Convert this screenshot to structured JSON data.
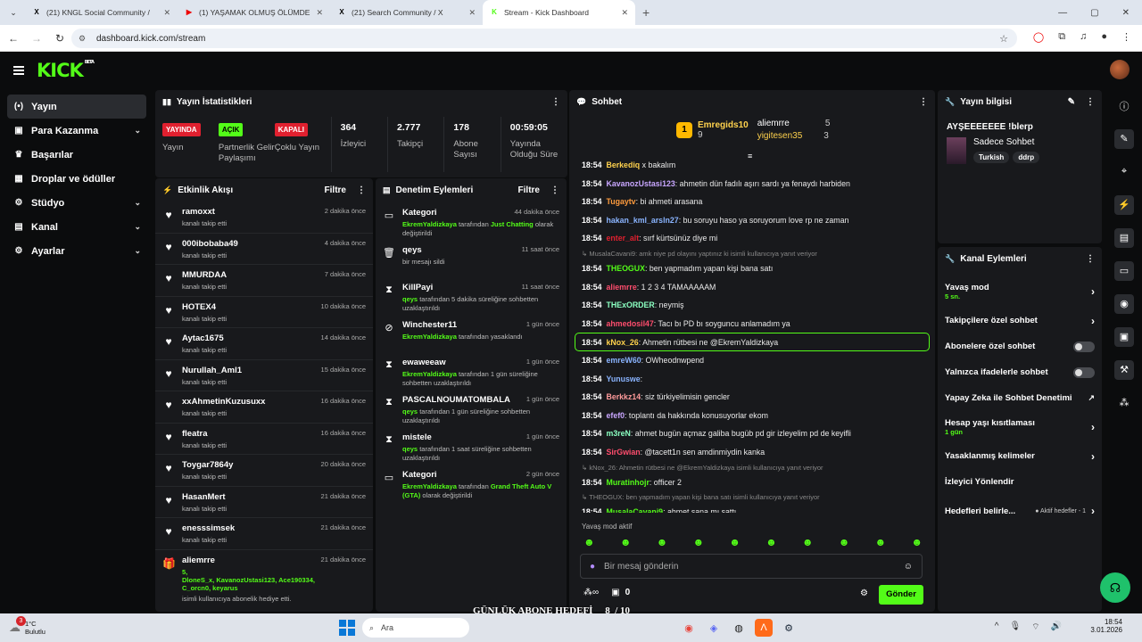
{
  "browser": {
    "tabs": [
      {
        "icon": "X",
        "title": "(21) KNGL Social Community / ",
        "color": "#000"
      },
      {
        "icon": "▶",
        "title": "(1) YAŞAMAK OLMUŞ ÖLÜMDE",
        "color": "#e00"
      },
      {
        "icon": "X",
        "title": "(21) Search Community / X",
        "color": "#000"
      },
      {
        "icon": "K",
        "title": "Stream - Kick Dashboard",
        "color": "#53fc18"
      }
    ],
    "url": "dashboard.kick.com/stream"
  },
  "nav": [
    {
      "icon": "(•)",
      "label": "Yayın",
      "active": true
    },
    {
      "icon": "▣",
      "label": "Para Kazanma",
      "chev": true
    },
    {
      "icon": "♛",
      "label": "Başarılar"
    },
    {
      "icon": "▦",
      "label": "Droplar ve ödüller"
    },
    {
      "icon": "⚙",
      "label": "Stüdyo",
      "chev": true
    },
    {
      "icon": "▤",
      "label": "Kanal",
      "chev": true
    },
    {
      "icon": "⚙",
      "label": "Ayarlar",
      "chev": true
    }
  ],
  "stats": {
    "title": "Yayın İstatistikleri",
    "badges": [
      {
        "text": "YAYINDA",
        "bg": "#e0202f",
        "fg": "#fff",
        "label": "Yayın"
      },
      {
        "text": "AÇIK",
        "bg": "#53fc18",
        "fg": "#000",
        "label": "Partnerlik Gelir Paylaşımı"
      },
      {
        "text": "KAPALI",
        "bg": "#e0202f",
        "fg": "#fff",
        "label": "Çoklu Yayın"
      }
    ],
    "nums": [
      {
        "value": "364",
        "label": "İzleyici"
      },
      {
        "value": "2.777",
        "label": "Takipçi"
      },
      {
        "value": "178",
        "label": "Abone Sayısı"
      },
      {
        "value": "00:59:05",
        "label": "Yayında Olduğu Süre"
      }
    ]
  },
  "activity": {
    "title": "Etkinlik Akışı",
    "filter": "Filtre",
    "items": [
      {
        "name": "ramoxxt",
        "sub": "kanalı takip etti",
        "time": "2 dakika önce"
      },
      {
        "name": "000ibobaba49",
        "sub": "kanalı takip etti",
        "time": "4 dakika önce"
      },
      {
        "name": "MMURDAA",
        "sub": "kanalı takip etti",
        "time": "7 dakika önce"
      },
      {
        "name": "HOTEX4",
        "sub": "kanalı takip etti",
        "time": "10 dakika önce"
      },
      {
        "name": "Aytac1675",
        "sub": "kanalı takip etti",
        "time": "14 dakika önce"
      },
      {
        "name": "Nurullah_Aml1",
        "sub": "kanalı takip etti",
        "time": "15 dakika önce"
      },
      {
        "name": "xxAhmetinKuzusuxx",
        "sub": "kanalı takip etti",
        "time": "16 dakika önce"
      },
      {
        "name": "fleatra",
        "sub": "kanalı takip etti",
        "time": "16 dakika önce"
      },
      {
        "name": "Toygar7864y",
        "sub": "kanalı takip etti",
        "time": "20 dakika önce"
      },
      {
        "name": "HasanMert",
        "sub": "kanalı takip etti",
        "time": "21 dakika önce"
      },
      {
        "name": "enesssimsek",
        "sub": "kanalı takip etti",
        "time": "21 dakika önce"
      }
    ],
    "gift": {
      "name": "aliemrre",
      "count": "5,",
      "recipients": "DloneS_x, KavanozUstasi123, Ace190334, C_orcn0, keyarus",
      "sub": "isimli kullanıcıya abonelik hediye etti.",
      "time": "21 dakika önce"
    }
  },
  "mod": {
    "title": "Denetim Eylemleri",
    "filter": "Filtre",
    "items": [
      {
        "icon": "▭",
        "title": "Kategori",
        "time": "44 dakika önce",
        "user": "EkremYaldizkaya",
        "text": " tarafından ",
        "extra": "Just Chatting",
        "tail": " olarak değiştirildi"
      },
      {
        "icon": "🗑",
        "title": "qeys",
        "time": "11 saat önce",
        "user": "",
        "text": "bir mesajı sildi",
        "extra": "",
        "tail": ""
      },
      {
        "icon": "⧗",
        "title": "KillPayi",
        "time": "11 saat önce",
        "user": "qeys",
        "text": " tarafından 5 dakika süreliğine sohbetten uzaklaştırıldı",
        "extra": "",
        "tail": ""
      },
      {
        "icon": "⊘",
        "title": "Winchester11",
        "time": "1 gün önce",
        "user": "EkremYaldizkaya",
        "text": " tarafından yasaklandı",
        "extra": "",
        "tail": ""
      },
      {
        "icon": "⧗",
        "title": "ewaweeaw",
        "time": "1 gün önce",
        "user": "EkremYaldizkaya",
        "text": " tarafından 1 gün süreliğine sohbetten uzaklaştırıldı",
        "extra": "",
        "tail": ""
      },
      {
        "icon": "⧗",
        "title": "PASCALNOUMATOMBALA",
        "time": "1 gün önce",
        "user": "qeys",
        "text": " tarafından 1 gün süreliğine sohbetten uzaklaştırıldı",
        "extra": "",
        "tail": ""
      },
      {
        "icon": "⧗",
        "title": "mistele",
        "time": "1 gün önce",
        "user": "qeys",
        "text": " tarafından 1 saat süreliğine sohbetten uzaklaştırıldı",
        "extra": "",
        "tail": ""
      },
      {
        "icon": "▭",
        "title": "Kategori",
        "time": "2 gün önce",
        "user": "EkremYaldizkaya",
        "text": " tarafından ",
        "extra": "Grand Theft Auto V (GTA)",
        "tail": " olarak değiştirildi"
      }
    ]
  },
  "chat": {
    "title": "Sohbet",
    "leaders": [
      {
        "name": "Emregids10",
        "n": "9",
        "rank": "1"
      },
      {
        "name": "aliemrre",
        "n": "5"
      },
      {
        "name": "yigitesen35",
        "n": "3"
      }
    ],
    "messages": [
      {
        "t": "18:54",
        "u": "Berkediq",
        "c": "#ffd24d",
        "m": " x bakalım"
      },
      {
        "t": "18:54",
        "u": "KavanozUstasi123",
        "c": "#c8a6ff",
        "m": ": ahmetin dün fadılı aşırı sardı ya fenaydı harbiden"
      },
      {
        "t": "18:54",
        "u": "Tugaytv",
        "c": "#ff9b3d",
        "m": ": bi ahmeti arasana"
      },
      {
        "t": "18:54",
        "u": "hakan_kml_arsln27",
        "c": "#8ab4ff",
        "m": ": bu soruyu haso ya soruyorum love rp ne zaman"
      },
      {
        "t": "18:54",
        "u": "enter_alt",
        "c": "#e0202f",
        "m": ": sırf kürtsünüz diye mi"
      },
      {
        "sys": "MusalaCavani9: amk niye pd olayını yaptınız ki isimli kullanıcıya yanıt veriyor"
      },
      {
        "t": "18:54",
        "u": "THEOGUX",
        "c": "#53fc18",
        "m": ": ben yapmadım yapan kişi bana satı"
      },
      {
        "t": "18:54",
        "u": "aliemrre",
        "c": "#ff4d6d",
        "m": ": 1 2 3 4 TAMAAAAAM"
      },
      {
        "t": "18:54",
        "u": "THExORDER",
        "c": "#8affc1",
        "m": ": neymiş"
      },
      {
        "t": "18:54",
        "u": "ahmedosil47",
        "c": "#ff4d6d",
        "m": ": Tacı bı PD bı soyguncu anlamadım ya"
      },
      {
        "t": "18:54",
        "u": "kNox_26",
        "c": "#ffd24d",
        "m": ": Ahmetin rütbesi ne @EkremYaldizkaya",
        "hl": true
      },
      {
        "t": "18:54",
        "u": "emreW60",
        "c": "#8ab4ff",
        "m": ": OWheodnwpend"
      },
      {
        "t": "18:54",
        "u": "Yunuswe",
        "c": "#8ab4ff",
        "m": ": "
      },
      {
        "t": "18:54",
        "u": "Berkkz14",
        "c": "#ff9b9b",
        "m": ": siz türkiyelimisin gencler"
      },
      {
        "t": "18:54",
        "u": "efef0",
        "c": "#c8a6ff",
        "m": ": toplantı da hakkında konusuyorlar ekom"
      },
      {
        "t": "18:54",
        "u": "m3reN",
        "c": "#8affc1",
        "m": ": ahmet bugün açmaz galiba bugüb pd gir izleyelim pd de keyifli"
      },
      {
        "t": "18:54",
        "u": "SirGwian",
        "c": "#ff4d6d",
        "m": ": @tacett1n sen amdinmiydin kanka"
      },
      {
        "sys": "kNox_26: Ahmetin rütbesi ne @EkremYaldizkaya isimli kullanıcıya yanıt veriyor"
      },
      {
        "t": "18:54",
        "u": "Muratinhojr",
        "c": "#53fc18",
        "m": ": officer 2"
      },
      {
        "sys": "THEOGUX: ben yapmadım yapan kişi bana satı isimli kullanıcıya yanıt veriyor"
      },
      {
        "t": "18:54",
        "u": "MusalaCavani9",
        "c": "#53fc18",
        "m": ": ahmet sana mı sattı"
      }
    ],
    "slow": "Yavaş mod aktif",
    "input_placeholder": "Bir mesaj gönderin",
    "counter": "0",
    "send": "Gönder",
    "overlay": "GÜNLÜK ABONE HEDEFİ     8  / 10"
  },
  "info": {
    "title": "Yayın bilgisi",
    "stream_title": "AYŞEEEEEEE !blerp",
    "category": "Sadece Sohbet",
    "tags": [
      "Turkish",
      "ddrp"
    ]
  },
  "channel": {
    "title": "Kanal Eylemleri",
    "rows": [
      {
        "label": "Yavaş mod",
        "sub": "5 sn.",
        "type": "chev"
      },
      {
        "label": "Takipçilere özel sohbet",
        "type": "chev"
      },
      {
        "label": "Abonelere özel sohbet",
        "type": "toggle"
      },
      {
        "label": "Yalnızca ifadelerle sohbet",
        "type": "toggle"
      },
      {
        "label": "Yapay Zeka ile Sohbet Denetimi",
        "type": "ext"
      },
      {
        "label": "Hesap yaşı kısıtlaması",
        "sub": "1 gün",
        "type": "chev"
      },
      {
        "label": "Yasaklanmış kelimeler",
        "type": "chev"
      },
      {
        "label": "İzleyici Yönlendir",
        "type": "none"
      },
      {
        "label": "Hedefleri belirle...",
        "sub": "● Aktif hedefler - 1",
        "type": "chev"
      }
    ]
  },
  "taskbar": {
    "weather_temp": "1°C",
    "weather_text": "Bulutlu",
    "search": "Ara",
    "time": "18:54",
    "date": "3.01.2026",
    "badge": "3"
  }
}
